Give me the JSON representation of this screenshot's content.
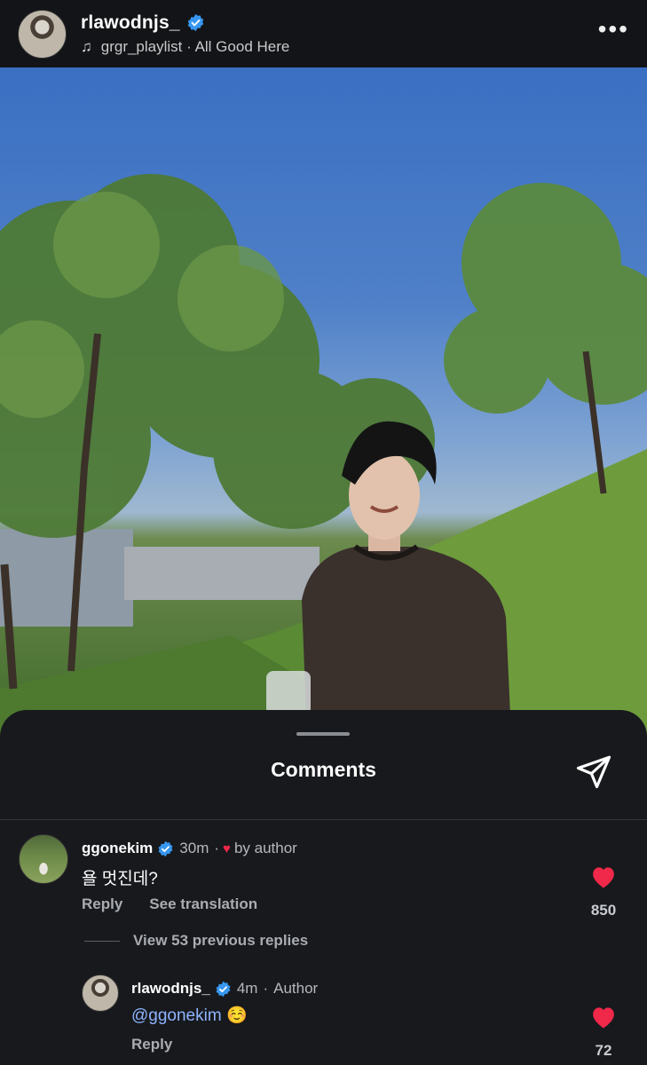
{
  "header": {
    "username": "rlawodnjs_",
    "music": "grgr_playlist · All Good Here"
  },
  "sheet": {
    "title": "Comments"
  },
  "comments": [
    {
      "username": "ggonekim",
      "time": "30m",
      "dot": "·",
      "by_author": "by author",
      "text": "욜 멋진데?",
      "reply": "Reply",
      "translate": "See translation",
      "likes": "850"
    }
  ],
  "view_replies": "View 53 previous replies",
  "reply": {
    "username": "rlawodnjs_",
    "time": "4m",
    "dot": "·",
    "badge": "Author",
    "mention": "@ggonekim",
    "emoji": "☺️",
    "reply": "Reply",
    "likes": "72"
  },
  "colors": {
    "verified": "#3797f0",
    "heart": "#f02849",
    "sheet_bg": "#17191d"
  }
}
